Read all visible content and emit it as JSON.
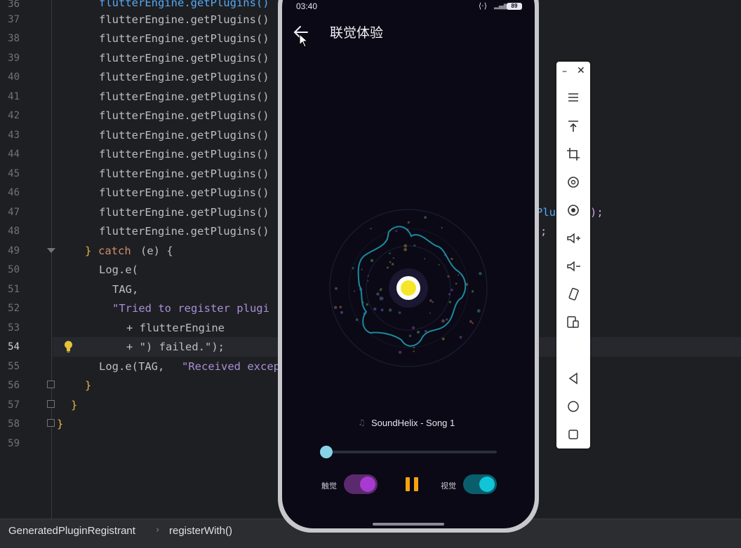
{
  "editor": {
    "line_numbers": [
      "36",
      "37",
      "38",
      "39",
      "40",
      "41",
      "42",
      "43",
      "44",
      "45",
      "46",
      "47",
      "48",
      "49",
      "50",
      "51",
      "52",
      "53",
      "54",
      "55",
      "56",
      "57",
      "58",
      "59"
    ],
    "current_line": "54",
    "lines": {
      "l36": "flutterEngine.getPlugins()",
      "l37": "flutterEngine.getPlugins()",
      "l38": "flutterEngine.getPlugins()",
      "l39": "flutterEngine.getPlugins()",
      "l40": "flutterEngine.getPlugins()",
      "l41": "flutterEngine.getPlugins()",
      "l42": "flutterEngine.getPlugins()",
      "l43": "flutterEngine.getPlugins()",
      "l44": "flutterEngine.getPlugins()",
      "l45": "flutterEngine.getPlugins()",
      "l46": "flutterEngine.getPlugins()",
      "l47": "flutterEngine.getPlugins()",
      "l48": "flutterEngine.getPlugins()",
      "l47_tail": "Plug",
      "l47_end": ");",
      "l48_end": ";",
      "l49_brace": "}",
      "l49_catch": "catch",
      "l49_rest": "(e) {",
      "l50": "Log.e(",
      "l51": "TAG,",
      "l52": "\"Tried to register plugi",
      "l53": "+ flutterEngine",
      "l54": "+ \") failed.\");",
      "l55_a": "Log.e(TAG, ",
      "l55_b": "\"Received excep",
      "l56": "}",
      "l57": "}",
      "l58": "}"
    }
  },
  "breadcrumb": {
    "class_name": "GeneratedPluginRegistrant",
    "method_name": "registerWith()"
  },
  "phone": {
    "status_time": "03:40",
    "battery": "89",
    "app_title": "联觉体验",
    "song_title": "SoundHelix - Song 1",
    "song_icon": "music-note-icon",
    "progress": 0.0,
    "haptic_label": "触觉",
    "haptic_on": true,
    "visual_label": "视觉",
    "visual_on": true,
    "play_state": "playing",
    "colors": {
      "background": "#0a0915",
      "accent_pause": "#f7a20f",
      "haptic": "#a73ad1",
      "visual": "#11c4d6",
      "slider": "#86d3e6",
      "center_dot": "#f5e62a"
    }
  },
  "toolbar": {
    "items": [
      "minimize-icon",
      "close-icon",
      "menu-icon",
      "pin-top-icon",
      "crop-icon",
      "rotate-icon",
      "screen-record-icon",
      "volume-up-icon",
      "volume-down-icon",
      "rotate-screen-icon",
      "device-icon",
      "back-nav-icon",
      "home-nav-icon",
      "recents-nav-icon"
    ]
  }
}
